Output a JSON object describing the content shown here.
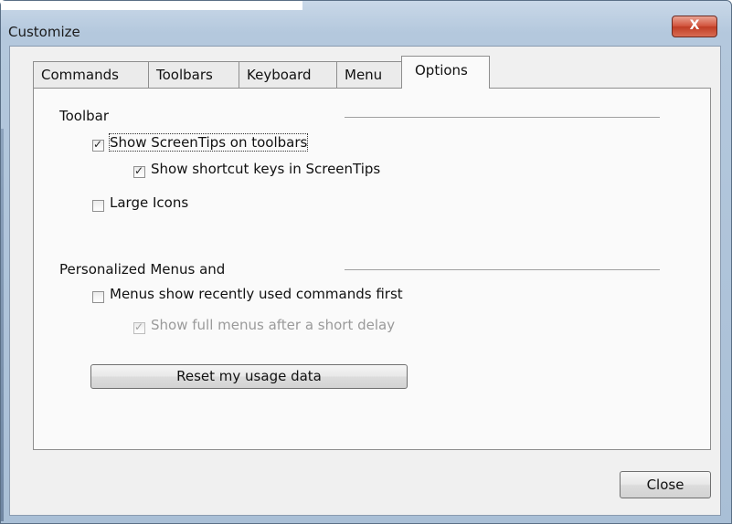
{
  "window": {
    "title": "Customize",
    "close_glyph": "X"
  },
  "tabs": [
    {
      "label": "Commands",
      "active": false
    },
    {
      "label": "Toolbars",
      "active": false
    },
    {
      "label": "Keyboard",
      "active": false
    },
    {
      "label": "Menu",
      "active": false
    },
    {
      "label": "Options",
      "active": true
    }
  ],
  "toolbar_group": {
    "label": "Toolbar",
    "show_screentips": {
      "label": "Show ScreenTips on toolbars",
      "checked": true
    },
    "show_shortcut_keys": {
      "label": "Show shortcut keys in ScreenTips",
      "checked": true
    },
    "large_icons": {
      "label": "Large Icons",
      "checked": false
    }
  },
  "menus_group": {
    "label": "Personalized Menus and",
    "recent_first": {
      "label": "Menus show recently used commands first",
      "checked": false
    },
    "full_menus_delay": {
      "label": "Show full menus after a short delay",
      "checked": true,
      "disabled": true
    },
    "reset_button": "Reset my usage data"
  },
  "footer": {
    "close_button": "Close"
  }
}
